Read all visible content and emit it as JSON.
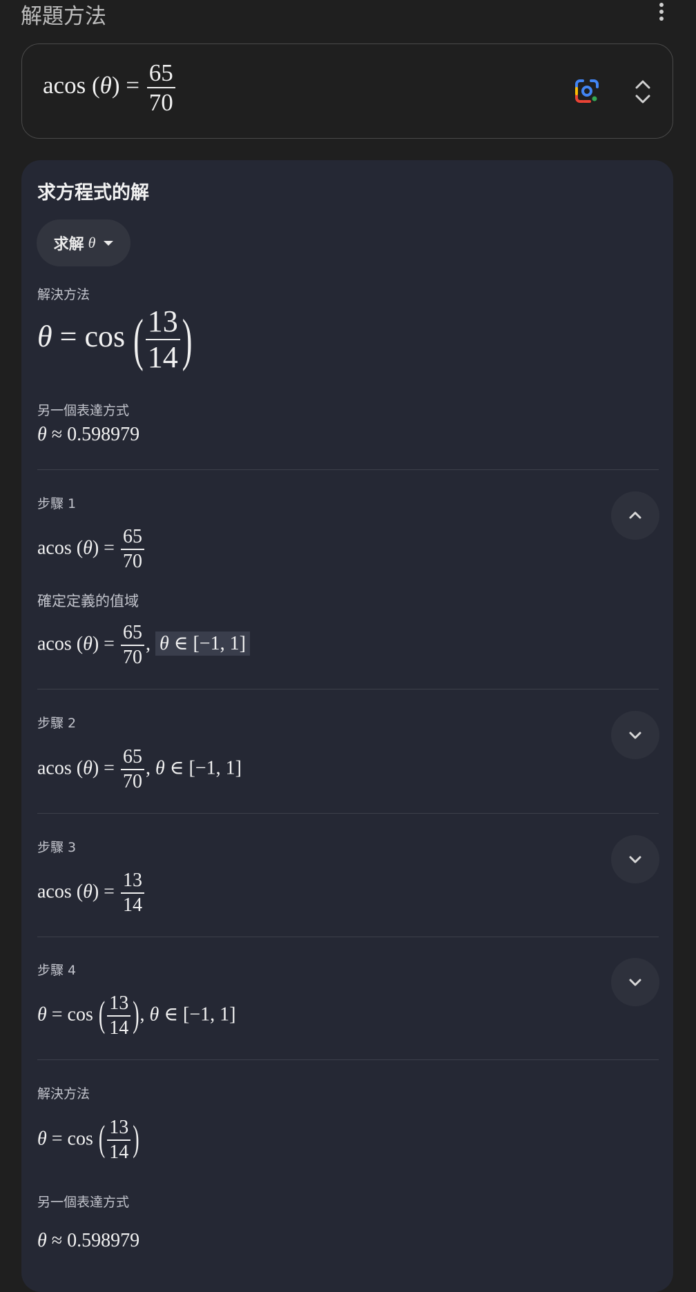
{
  "header": {
    "title": "解題方法",
    "more_icon": "more-vert-icon"
  },
  "equation_box": {
    "lhs": "acos",
    "var": "θ",
    "num": "65",
    "den": "70",
    "lens_icon": "google-lens-icon",
    "expand_icon": "unfold-icon"
  },
  "card": {
    "title": "求方程式的解",
    "solve_chip": {
      "label": "求解",
      "var": "θ"
    },
    "solution_label": "解決方法",
    "solution": {
      "var": "θ",
      "func": "cos",
      "num": "13",
      "den": "14"
    },
    "alt_label": "另一個表達方式",
    "alt_value": "0.598979",
    "steps": [
      {
        "label": "步驟 1",
        "expanded": true,
        "math": {
          "num": "65",
          "den": "70"
        },
        "note": "確定定義的值域",
        "domain_math": {
          "num": "65",
          "den": "70",
          "domain": "[−1, 1]"
        }
      },
      {
        "label": "步驟 2",
        "math": {
          "num": "65",
          "den": "70",
          "domain": "[−1, 1]"
        }
      },
      {
        "label": "步驟 3",
        "math": {
          "num": "13",
          "den": "14"
        }
      },
      {
        "label": "步驟 4",
        "math": {
          "num": "13",
          "den": "14",
          "domain": "[−1, 1]"
        }
      }
    ],
    "final_label": "解決方法",
    "final": {
      "num": "13",
      "den": "14"
    },
    "final_alt_label": "另一個表達方式",
    "final_alt_value": "0.598979"
  },
  "colors": {
    "background": "#1f1f1f",
    "card": "#252834",
    "text": "#e3e3e3"
  }
}
